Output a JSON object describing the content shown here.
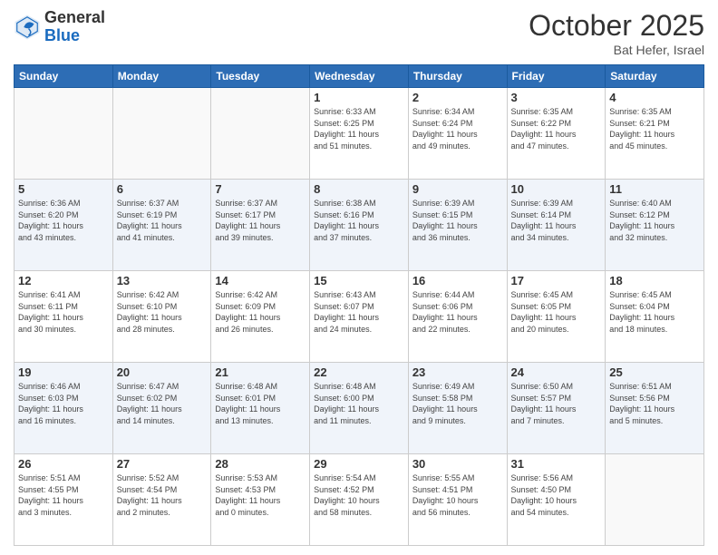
{
  "logo": {
    "general": "General",
    "blue": "Blue"
  },
  "header": {
    "month": "October 2025",
    "location": "Bat Hefer, Israel"
  },
  "days_of_week": [
    "Sunday",
    "Monday",
    "Tuesday",
    "Wednesday",
    "Thursday",
    "Friday",
    "Saturday"
  ],
  "weeks": [
    [
      {
        "day": "",
        "info": ""
      },
      {
        "day": "",
        "info": ""
      },
      {
        "day": "",
        "info": ""
      },
      {
        "day": "1",
        "info": "Sunrise: 6:33 AM\nSunset: 6:25 PM\nDaylight: 11 hours\nand 51 minutes."
      },
      {
        "day": "2",
        "info": "Sunrise: 6:34 AM\nSunset: 6:24 PM\nDaylight: 11 hours\nand 49 minutes."
      },
      {
        "day": "3",
        "info": "Sunrise: 6:35 AM\nSunset: 6:22 PM\nDaylight: 11 hours\nand 47 minutes."
      },
      {
        "day": "4",
        "info": "Sunrise: 6:35 AM\nSunset: 6:21 PM\nDaylight: 11 hours\nand 45 minutes."
      }
    ],
    [
      {
        "day": "5",
        "info": "Sunrise: 6:36 AM\nSunset: 6:20 PM\nDaylight: 11 hours\nand 43 minutes."
      },
      {
        "day": "6",
        "info": "Sunrise: 6:37 AM\nSunset: 6:19 PM\nDaylight: 11 hours\nand 41 minutes."
      },
      {
        "day": "7",
        "info": "Sunrise: 6:37 AM\nSunset: 6:17 PM\nDaylight: 11 hours\nand 39 minutes."
      },
      {
        "day": "8",
        "info": "Sunrise: 6:38 AM\nSunset: 6:16 PM\nDaylight: 11 hours\nand 37 minutes."
      },
      {
        "day": "9",
        "info": "Sunrise: 6:39 AM\nSunset: 6:15 PM\nDaylight: 11 hours\nand 36 minutes."
      },
      {
        "day": "10",
        "info": "Sunrise: 6:39 AM\nSunset: 6:14 PM\nDaylight: 11 hours\nand 34 minutes."
      },
      {
        "day": "11",
        "info": "Sunrise: 6:40 AM\nSunset: 6:12 PM\nDaylight: 11 hours\nand 32 minutes."
      }
    ],
    [
      {
        "day": "12",
        "info": "Sunrise: 6:41 AM\nSunset: 6:11 PM\nDaylight: 11 hours\nand 30 minutes."
      },
      {
        "day": "13",
        "info": "Sunrise: 6:42 AM\nSunset: 6:10 PM\nDaylight: 11 hours\nand 28 minutes."
      },
      {
        "day": "14",
        "info": "Sunrise: 6:42 AM\nSunset: 6:09 PM\nDaylight: 11 hours\nand 26 minutes."
      },
      {
        "day": "15",
        "info": "Sunrise: 6:43 AM\nSunset: 6:07 PM\nDaylight: 11 hours\nand 24 minutes."
      },
      {
        "day": "16",
        "info": "Sunrise: 6:44 AM\nSunset: 6:06 PM\nDaylight: 11 hours\nand 22 minutes."
      },
      {
        "day": "17",
        "info": "Sunrise: 6:45 AM\nSunset: 6:05 PM\nDaylight: 11 hours\nand 20 minutes."
      },
      {
        "day": "18",
        "info": "Sunrise: 6:45 AM\nSunset: 6:04 PM\nDaylight: 11 hours\nand 18 minutes."
      }
    ],
    [
      {
        "day": "19",
        "info": "Sunrise: 6:46 AM\nSunset: 6:03 PM\nDaylight: 11 hours\nand 16 minutes."
      },
      {
        "day": "20",
        "info": "Sunrise: 6:47 AM\nSunset: 6:02 PM\nDaylight: 11 hours\nand 14 minutes."
      },
      {
        "day": "21",
        "info": "Sunrise: 6:48 AM\nSunset: 6:01 PM\nDaylight: 11 hours\nand 13 minutes."
      },
      {
        "day": "22",
        "info": "Sunrise: 6:48 AM\nSunset: 6:00 PM\nDaylight: 11 hours\nand 11 minutes."
      },
      {
        "day": "23",
        "info": "Sunrise: 6:49 AM\nSunset: 5:58 PM\nDaylight: 11 hours\nand 9 minutes."
      },
      {
        "day": "24",
        "info": "Sunrise: 6:50 AM\nSunset: 5:57 PM\nDaylight: 11 hours\nand 7 minutes."
      },
      {
        "day": "25",
        "info": "Sunrise: 6:51 AM\nSunset: 5:56 PM\nDaylight: 11 hours\nand 5 minutes."
      }
    ],
    [
      {
        "day": "26",
        "info": "Sunrise: 5:51 AM\nSunset: 4:55 PM\nDaylight: 11 hours\nand 3 minutes."
      },
      {
        "day": "27",
        "info": "Sunrise: 5:52 AM\nSunset: 4:54 PM\nDaylight: 11 hours\nand 2 minutes."
      },
      {
        "day": "28",
        "info": "Sunrise: 5:53 AM\nSunset: 4:53 PM\nDaylight: 11 hours\nand 0 minutes."
      },
      {
        "day": "29",
        "info": "Sunrise: 5:54 AM\nSunset: 4:52 PM\nDaylight: 10 hours\nand 58 minutes."
      },
      {
        "day": "30",
        "info": "Sunrise: 5:55 AM\nSunset: 4:51 PM\nDaylight: 10 hours\nand 56 minutes."
      },
      {
        "day": "31",
        "info": "Sunrise: 5:56 AM\nSunset: 4:50 PM\nDaylight: 10 hours\nand 54 minutes."
      },
      {
        "day": "",
        "info": ""
      }
    ]
  ]
}
